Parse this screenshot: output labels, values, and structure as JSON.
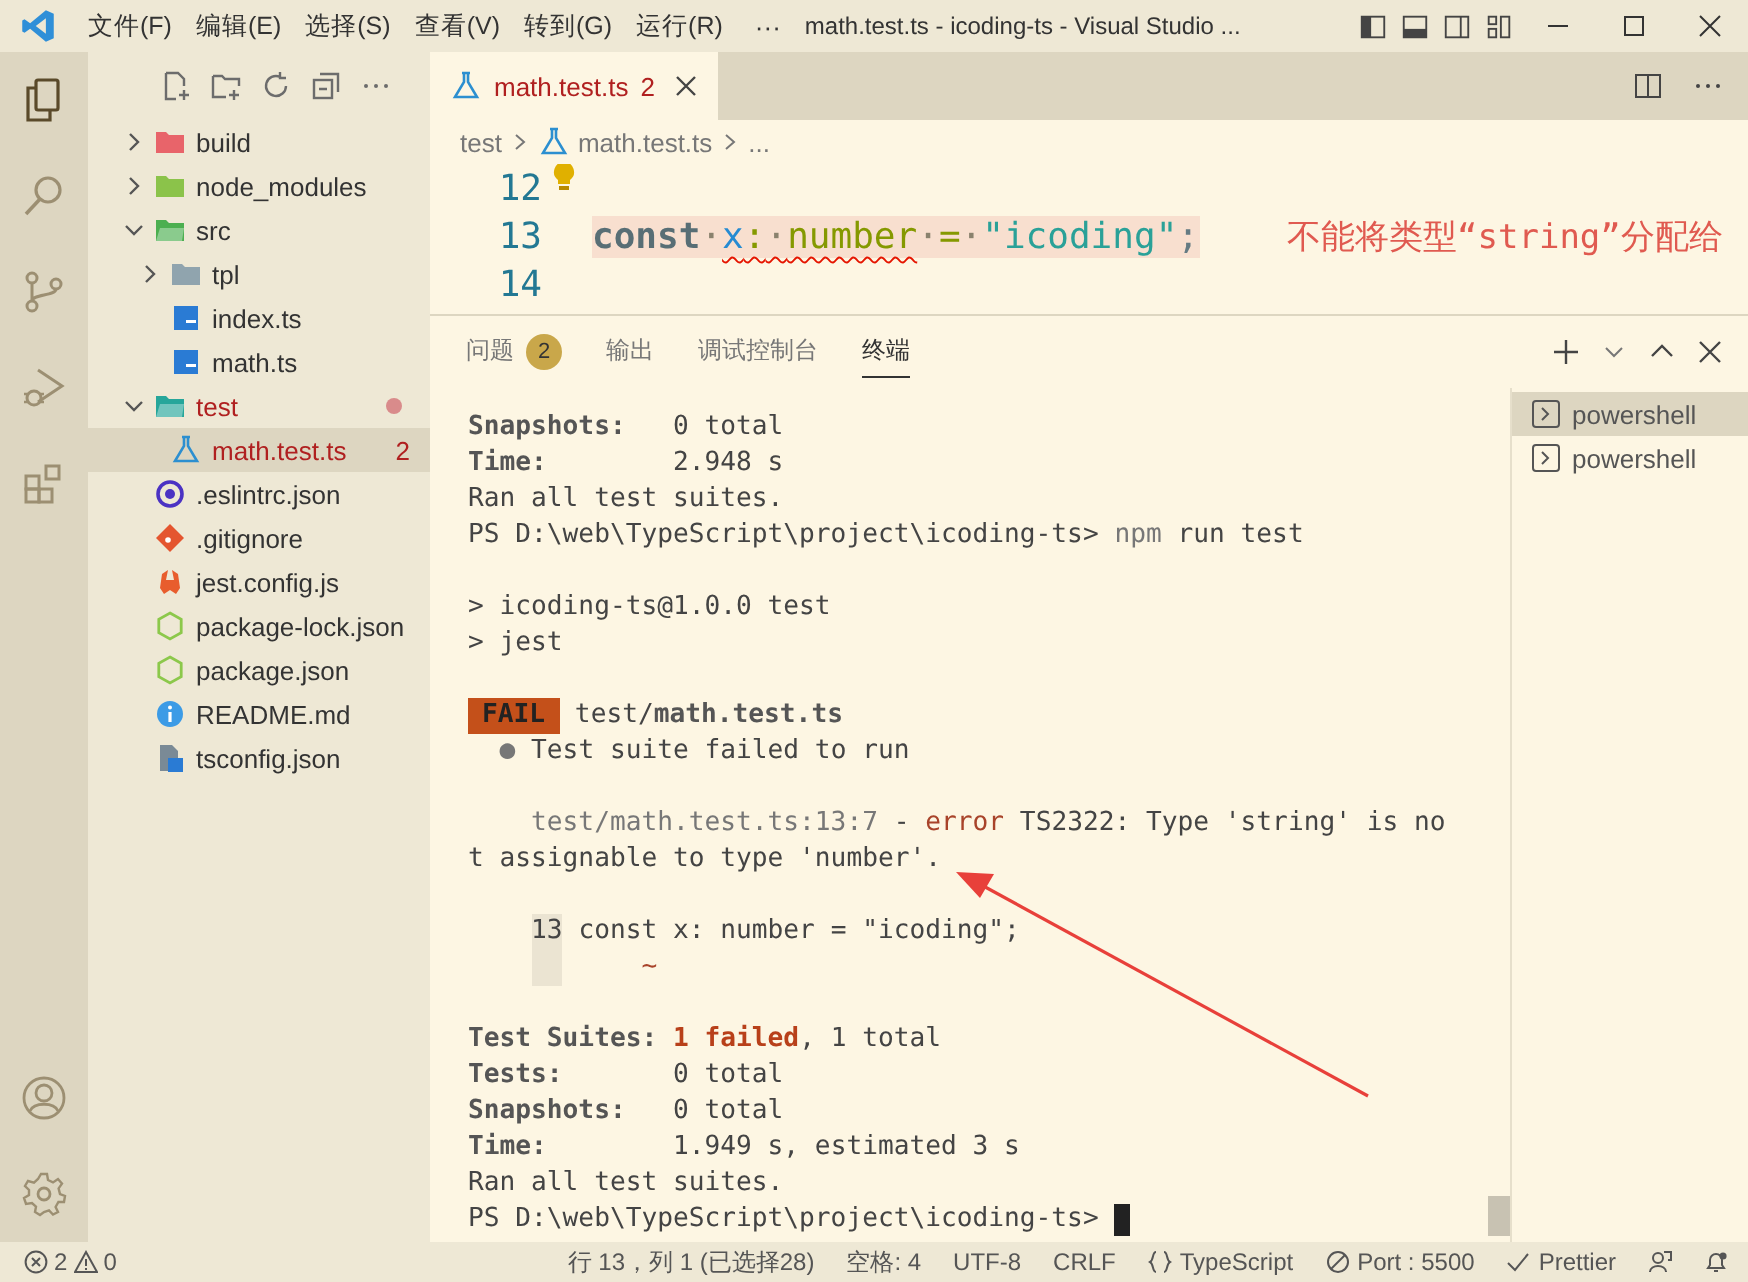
{
  "title_bar": {
    "menus": [
      "文件(F)",
      "编辑(E)",
      "选择(S)",
      "查看(V)",
      "转到(G)",
      "运行(R)"
    ],
    "overflow": "···",
    "title": "math.test.ts - icoding-ts - Visual Studio ..."
  },
  "activity_bar": {
    "items": [
      {
        "kind": "explorer",
        "selected": true
      },
      {
        "kind": "search",
        "selected": false
      },
      {
        "kind": "source-control",
        "selected": false
      },
      {
        "kind": "run-debug",
        "selected": false
      },
      {
        "kind": "extensions",
        "selected": false
      }
    ],
    "bottom": [
      {
        "kind": "account"
      },
      {
        "kind": "settings"
      }
    ]
  },
  "explorer": {
    "tree": [
      {
        "name": "build",
        "kind": "folder",
        "color": "#e8646a",
        "expanded": false
      },
      {
        "name": "node_modules",
        "kind": "folder",
        "color": "#8bc34a",
        "expanded": false
      },
      {
        "name": "src",
        "kind": "folder",
        "color": "#4caf50",
        "expanded": true,
        "children": [
          {
            "name": "tpl",
            "kind": "folder",
            "color": "#90a4ae",
            "expanded": false
          },
          {
            "name": "index.ts",
            "kind": "ts"
          },
          {
            "name": "math.ts",
            "kind": "ts"
          }
        ]
      },
      {
        "name": "test",
        "kind": "folder",
        "color": "#26a69a",
        "expanded": true,
        "error": true,
        "modified": true,
        "children": [
          {
            "name": "math.test.ts",
            "kind": "test",
            "error": true,
            "badge": "2",
            "selected": true
          }
        ]
      },
      {
        "name": ".eslintrc.json",
        "kind": "eslint"
      },
      {
        "name": ".gitignore",
        "kind": "git"
      },
      {
        "name": "jest.config.js",
        "kind": "jest"
      },
      {
        "name": "package-lock.json",
        "kind": "node"
      },
      {
        "name": "package.json",
        "kind": "node"
      },
      {
        "name": "README.md",
        "kind": "info"
      },
      {
        "name": "tsconfig.json",
        "kind": "tsconfig"
      }
    ]
  },
  "editor": {
    "tabs": [
      {
        "label": "math.test.ts",
        "badge": "2",
        "selected": true,
        "error": true
      }
    ],
    "breadcrumbs": [
      {
        "label": "test",
        "kind": "folder"
      },
      {
        "label": "math.test.ts",
        "kind": "test"
      },
      {
        "label": "...",
        "kind": "more"
      }
    ],
    "lines": [
      {
        "number": "12",
        "lightbulb": true
      },
      {
        "number": "13",
        "error": true,
        "message": "不能将类型“string”分配给",
        "tokens": [
          {
            "text": "const",
            "kind": "keyword"
          },
          {
            "text": "·",
            "kind": "ws"
          },
          {
            "text": "x",
            "kind": "variable",
            "squiggle": true
          },
          {
            "text": ":",
            "kind": "type",
            "squiggle": true
          },
          {
            "text": "·",
            "kind": "ws",
            "squiggle": true
          },
          {
            "text": "number",
            "kind": "type",
            "squiggle": true
          },
          {
            "text": "·",
            "kind": "ws"
          },
          {
            "text": "=",
            "kind": "operator"
          },
          {
            "text": "·",
            "kind": "ws"
          },
          {
            "text": "\"icoding\"",
            "kind": "string"
          },
          {
            "text": ";",
            "kind": "punct"
          }
        ]
      },
      {
        "number": "14"
      }
    ]
  },
  "panel": {
    "tabs": [
      {
        "label": "问题",
        "badge": "2",
        "selected": false
      },
      {
        "label": "输出",
        "selected": false
      },
      {
        "label": "调试控制台",
        "selected": false
      },
      {
        "label": "终端",
        "selected": true
      }
    ],
    "terminal": [
      [
        [
          {
            "kind": "bold",
            "text": "Snapshots:"
          },
          {
            "kind": "text",
            "text": "   0 total"
          }
        ],
        [
          {
            "kind": "bold",
            "text": "Time:"
          },
          {
            "kind": "text",
            "text": "        2.948 s"
          }
        ],
        [
          {
            "kind": "text",
            "text": "Ran all test suites."
          }
        ],
        [
          {
            "kind": "text",
            "text": "PS D:\\web\\TypeScript\\project\\icoding-ts> "
          },
          {
            "kind": "dim",
            "text": "npm"
          },
          {
            "kind": "text",
            "text": " run test"
          }
        ]
      ],
      [
        [
          {
            "kind": "text",
            "text": "> icoding-ts@1.0.0 test"
          }
        ],
        [
          {
            "kind": "text",
            "text": "> jest"
          }
        ]
      ],
      [
        [
          {
            "kind": "badge",
            "text": "FAIL"
          },
          {
            "kind": "text",
            "text": " test/"
          },
          {
            "kind": "bold",
            "text": "math.test.ts"
          }
        ],
        [
          {
            "kind": "dim",
            "text": "  ●"
          },
          {
            "kind": "text",
            "text": " Test suite failed to run"
          }
        ]
      ],
      [
        [
          {
            "kind": "dim",
            "text": "    test/math.test.ts:13:7"
          },
          {
            "kind": "text",
            "text": " - "
          },
          {
            "kind": "error",
            "text": "error"
          },
          {
            "kind": "text",
            "text": " TS2322: Type 'string' is no"
          }
        ],
        [
          {
            "kind": "text",
            "text": "t assignable to type 'number'."
          }
        ]
      ],
      [
        [
          {
            "kind": "gutter",
            "text": "13"
          },
          {
            "kind": "text",
            "text": " const x: number = \"icoding\";"
          }
        ],
        [
          {
            "kind": "gutter-blank"
          },
          {
            "kind": "error",
            "text": "     ~"
          }
        ]
      ],
      [
        [
          {
            "kind": "bold",
            "text": "Test Suites: "
          },
          {
            "kind": "error-bold",
            "text": "1 failed"
          },
          {
            "kind": "text",
            "text": ", 1 total"
          }
        ],
        [
          {
            "kind": "bold",
            "text": "Tests:"
          },
          {
            "kind": "text",
            "text": "       0 total"
          }
        ],
        [
          {
            "kind": "bold",
            "text": "Snapshots:"
          },
          {
            "kind": "text",
            "text": "   0 total"
          }
        ],
        [
          {
            "kind": "bold",
            "text": "Time:"
          },
          {
            "kind": "text",
            "text": "        1.949 s, estimated 3 s"
          }
        ],
        [
          {
            "kind": "text",
            "text": "Ran all test suites."
          }
        ],
        [
          {
            "kind": "text",
            "text": "PS D:\\web\\TypeScript\\project\\icoding-ts> "
          },
          {
            "kind": "cursor"
          }
        ]
      ]
    ],
    "sessions": [
      {
        "label": "powershell",
        "selected": true
      },
      {
        "label": "powershell",
        "selected": false
      }
    ]
  },
  "status_bar": {
    "errors": "2",
    "warnings": "0",
    "items": [
      {
        "kind": "text",
        "label": "行 13，列 1 (已选择28)"
      },
      {
        "kind": "text",
        "label": "空格: 4"
      },
      {
        "kind": "text",
        "label": "UTF-8"
      },
      {
        "kind": "text",
        "label": "CRLF"
      },
      {
        "kind": "language",
        "label": "TypeScript"
      },
      {
        "kind": "port",
        "label": "Port : 5500"
      },
      {
        "kind": "check",
        "label": "Prettier"
      },
      {
        "kind": "feedback"
      },
      {
        "kind": "bell"
      }
    ]
  }
}
